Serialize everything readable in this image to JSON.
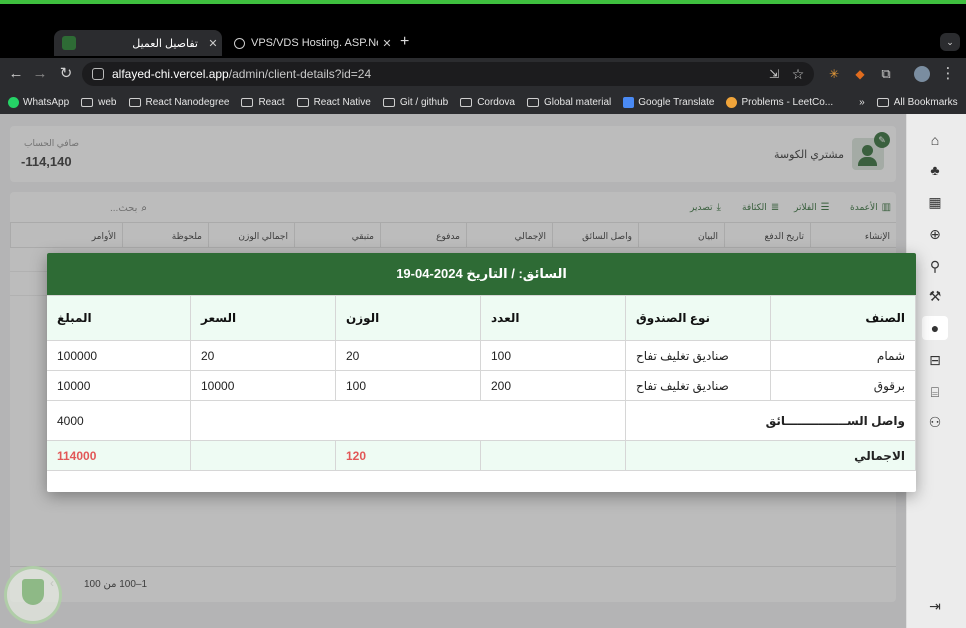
{
  "browser": {
    "tabs": [
      {
        "title": "تفاصيل العميل"
      },
      {
        "title": "VPS/VDS Hosting. ASP.Net M"
      }
    ],
    "url_host": "alfayed-chi.vercel.app",
    "url_path": "/admin/client-details?id=24",
    "bookmarks": [
      "WhatsApp",
      "web",
      "React Nanodegree",
      "React",
      "React Native",
      "Git / github",
      "Cordova",
      "Global material",
      "Google Translate",
      "Problems - LeetCo..."
    ],
    "all_bookmarks": "All Bookmarks"
  },
  "client": {
    "name": "مشتري الكوسة",
    "balance_label": "صافي الحساب",
    "balance": "-114,140"
  },
  "toolbar": {
    "columns": "الأعمدة",
    "filters": "الفلاتر",
    "density": "الكثافة",
    "export": "تصدير",
    "search_placeholder": "بحث..."
  },
  "table_columns": [
    "الإنشاء",
    "تاريخ الدفع",
    "البيان",
    "واصل السائق",
    "الإجمالي",
    "مدفوع",
    "متبقي",
    "اجمالي الوزن",
    "ملحوظة",
    "الأوامر"
  ],
  "pagination": {
    "range": "1–100 من 100"
  },
  "modal": {
    "title": "السائق: / التاريخ 2024-04-19",
    "headers": [
      "الصنف",
      "نوع الصندوق",
      "العدد",
      "الوزن",
      "السعر",
      "المبلغ"
    ],
    "rows": [
      [
        "شمام",
        "صناديق تغليف تفاح",
        "100",
        "20",
        "20",
        "100000"
      ],
      [
        "برقوق",
        "صناديق تغليف تفاح",
        "200",
        "100",
        "10000",
        "10000"
      ]
    ],
    "driver_label": "واصل الســـــــــــــــائق",
    "driver_amount": "4000",
    "total_label": "الاجمالي",
    "total_weight": "120",
    "total_amount": "114000"
  },
  "colors": {
    "primary": "#2e6b35",
    "total_red": "#e25757",
    "header_bg": "#eefbf3"
  }
}
